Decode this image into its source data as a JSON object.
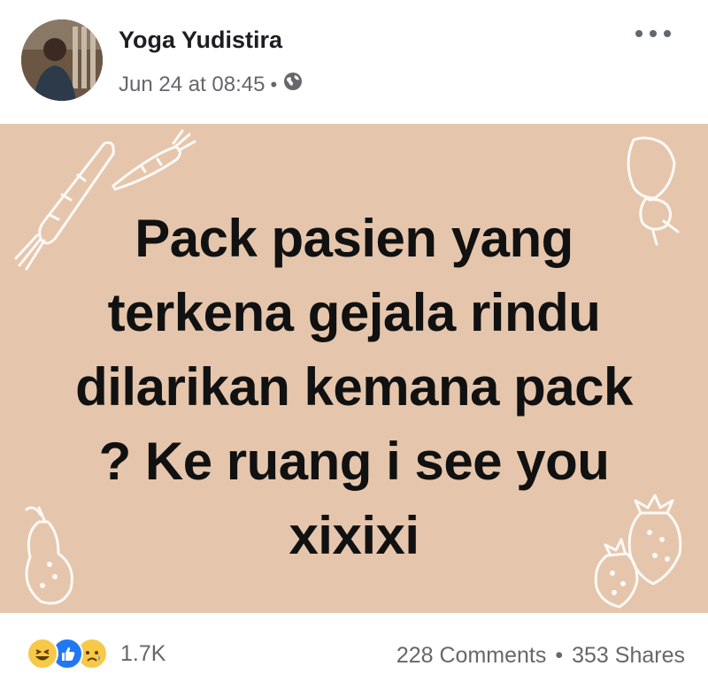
{
  "post": {
    "author": "Yoga Yudistira",
    "date": "Jun 24 at 08:45",
    "separator": "•",
    "privacy_icon": "globe-icon",
    "menu_icon": "more-options-icon",
    "text": "Pack pasien yang terkena gejala rindu dilarikan kemana pack ? Ke ruang i see you xixixi",
    "background_color": "#e5c6ac"
  },
  "footer": {
    "reactions": [
      "haha-reaction-icon",
      "like-reaction-icon",
      "sad-reaction-icon"
    ],
    "reaction_count": "1.7K",
    "comments": "228 Comments",
    "separator": "•",
    "shares": "353 Shares"
  }
}
